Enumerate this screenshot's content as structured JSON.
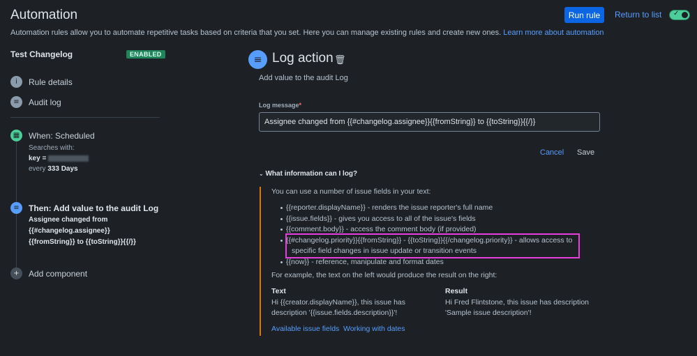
{
  "header": {
    "title": "Automation",
    "run_rule": "Run rule",
    "return_to_list": "Return to list",
    "intro": "Automation rules allow you to automate repetitive tasks based on criteria that you set. Here you can manage existing rules and create new ones.",
    "learn_more": "Learn more about automation"
  },
  "sidebar": {
    "rule_name": "Test Changelog",
    "status_badge": "ENABLED",
    "rule_details": "Rule details",
    "audit_log": "Audit log",
    "trigger": {
      "title": "When: Scheduled",
      "searches_with": "Searches with:",
      "key_label": "key =",
      "every": "every",
      "interval": "333 Days"
    },
    "action": {
      "title": "Then: Add value to the audit Log",
      "line1": "Assignee changed from",
      "line2": "{{#changelog.assignee}}",
      "line3": "{{fromString}} to {{toString}}{{/}}"
    },
    "add_component": "Add component"
  },
  "pane": {
    "title": "Log action",
    "subtitle": "Add value to the audit Log",
    "field_label": "Log message",
    "required_mark": "*",
    "field_value": "Assignee changed from {{#changelog.assignee}}{{fromString}} to {{toString}}{{/}}",
    "cancel": "Cancel",
    "save": "Save",
    "help": {
      "toggle": "What information can I log?",
      "intro": "You can use a number of issue fields in your text:",
      "items": [
        "{{reporter.displayName}} - renders the issue reporter's full name",
        "{{issue.fields}} - gives you access to all of the issue's fields",
        "{{comment.body}} - access the comment body (if provided)",
        "{{#changelog.priority}}{{fromString}} - {{toString}}{{/changelog.priority}} - allows access to",
        "specific field changes in issue update or transition events",
        "{{now}} - reference, manipulate and format dates"
      ],
      "example_intro": "For example, the text on the left would produce the result on the right:",
      "text_header": "Text",
      "result_header": "Result",
      "text_line1": "Hi {{creator.displayName}}, this issue has",
      "text_line2": "description '{{issue.fields.description}}'!",
      "result_line1": "Hi Fred Flintstone, this issue has description",
      "result_line2": "'Sample issue description'!",
      "link_fields": "Available issue fields",
      "link_dates": "Working with dates"
    }
  },
  "colors": {
    "accent": "#0c66e4",
    "link": "#579dff",
    "highlight": "#e83ee0",
    "help_bar": "#e2740f",
    "enabled": "#1f845a"
  }
}
